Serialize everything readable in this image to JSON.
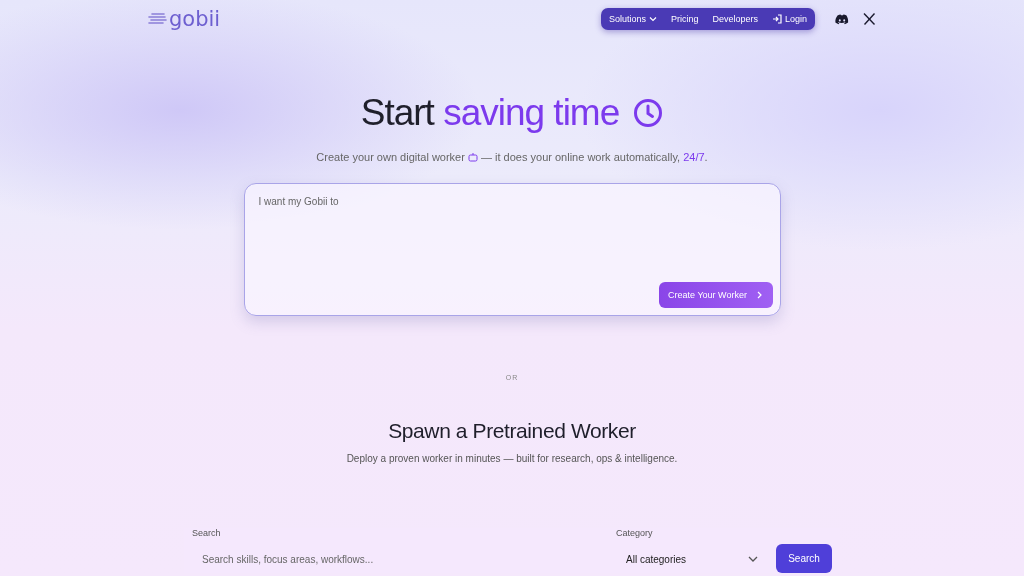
{
  "logo": {
    "text": "gobii"
  },
  "nav": {
    "items": [
      {
        "label": "Solutions",
        "kind": "dropdown"
      },
      {
        "label": "Pricing",
        "kind": "link"
      },
      {
        "label": "Developers",
        "kind": "link"
      },
      {
        "label": "Login",
        "kind": "login"
      }
    ]
  },
  "hero": {
    "title_plain": "Start",
    "title_accent": "saving time",
    "subtitle_before": "Create your own digital worker",
    "subtitle_after": "— it does your online work automatically,",
    "subtitle_highlight": "24/7",
    "subtitle_end": "."
  },
  "prompt": {
    "placeholder": "I want my Gobii to",
    "button": "Create Your Worker"
  },
  "divider": "OR",
  "pretrained": {
    "title": "Spawn a Pretrained Worker",
    "description": "Deploy a proven worker in minutes — built for research, ops & intelligence."
  },
  "filters": {
    "search_label": "Search",
    "search_placeholder": "Search skills, focus areas, workflows...",
    "category_label": "Category",
    "category_value": "All categories",
    "button": "Search"
  }
}
